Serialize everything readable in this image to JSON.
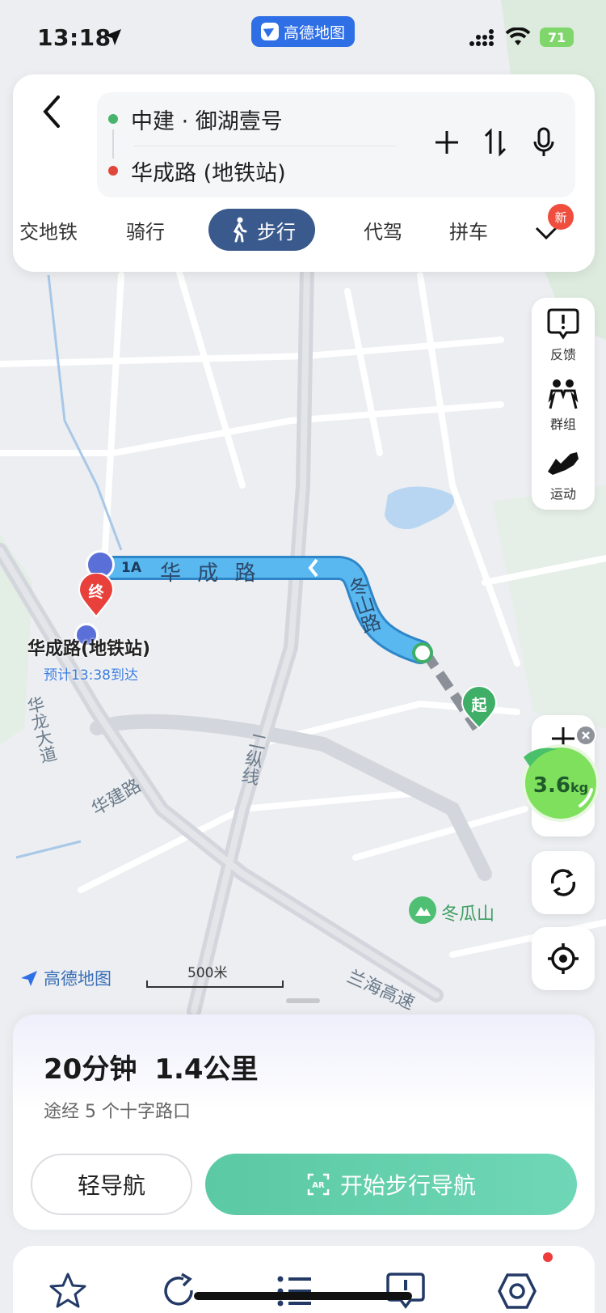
{
  "status_bar": {
    "time": "13:18",
    "app_name": "高德地图",
    "battery": "71"
  },
  "route": {
    "start": "中建 · 御湖壹号",
    "end": "华成路 (地铁站)",
    "start_color": "#47b46b",
    "end_color": "#e0473a"
  },
  "modes": {
    "tabs": [
      "交地铁",
      "骑行",
      "步行",
      "代驾",
      "拼车"
    ],
    "active": "步行",
    "new_badge": "新"
  },
  "tools": [
    {
      "icon": "feedback-icon",
      "label": "反馈"
    },
    {
      "icon": "group-icon",
      "label": "群组"
    },
    {
      "icon": "sport-shoe-icon",
      "label": "运动"
    }
  ],
  "eco": {
    "value": "3.6",
    "unit": "kg"
  },
  "map": {
    "road_huacheng": "华 成 路",
    "road_dongshan": "冬山路",
    "exit_label": "1A",
    "end_marker": "终",
    "start_marker": "起",
    "dest_name": "华成路(地铁站)",
    "dest_eta": "预计13:38到达",
    "road_hualong": "华龙大道",
    "road_huajian": "华建路",
    "road_erzong": "二纵线",
    "poi_name": "冬瓜山",
    "road_lanhai": "兰海高速",
    "scale": "500米",
    "brand": "高德地图",
    "route_color": "#4fb0ec"
  },
  "summary": {
    "duration": "20分钟",
    "distance": "1.4公里",
    "via": "途经 5 个十字路口",
    "light_nav": "轻导航",
    "start_nav": "开始步行导航"
  },
  "tabbar": {
    "icons": [
      "star-icon",
      "share-icon",
      "list-icon",
      "message-icon",
      "settings-icon"
    ]
  }
}
